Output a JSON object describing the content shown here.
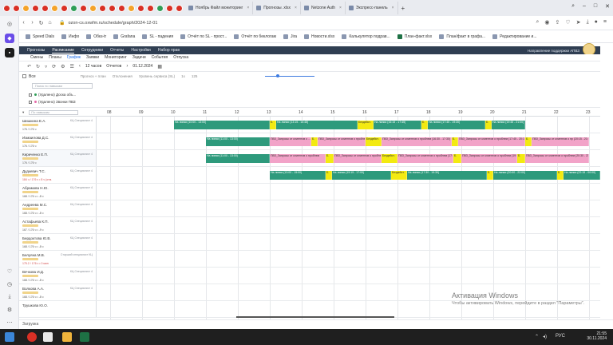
{
  "browser": {
    "tabs": [
      {
        "title": "Ноябрь Файл мониторинг"
      },
      {
        "title": "Прогнозы .xlsx"
      },
      {
        "title": "Netzone Auth"
      },
      {
        "title": "Экспресс-панель"
      }
    ],
    "url": "ozon-cs.oxwfm.ru/schedule/graph/2024-12-01",
    "bookmarks": [
      {
        "label": "Speed Dials"
      },
      {
        "label": "Инфо"
      },
      {
        "label": "Обкз-tr"
      },
      {
        "label": "Grafana"
      },
      {
        "label": "SL - падения"
      },
      {
        "label": "Отчёт по SL - прост..."
      },
      {
        "label": "Отчёт по беклогам"
      },
      {
        "label": "Jira"
      },
      {
        "label": "Новости.xlsx"
      },
      {
        "label": "Калькулятор подрав..."
      },
      {
        "label": "План-факт.xlsx"
      },
      {
        "label": "План/факт в графа..."
      },
      {
        "label": "Редактирование и..."
      }
    ]
  },
  "app": {
    "top_menu": [
      "Прогнозы",
      "Расписание",
      "Сотрудники",
      "Отчеты",
      "Настройки",
      "Набор прав"
    ],
    "active_top": "Расписание",
    "support": "Направление поддержки АПВЗ",
    "sub_menu": [
      "Смены",
      "Планы",
      "График",
      "Заявки",
      "Мониторинг",
      "Задачи",
      "События",
      "Отпуска"
    ],
    "active_sub": "График",
    "toolbar": {
      "view_hours": "12 часов",
      "view_span": "Отчетов",
      "date": "01.12.2024"
    },
    "filter": {
      "all_label": "Все",
      "options": [
        "Прогноз + план",
        "Отклонения",
        "Уровень сервиса (SL)",
        "1x",
        "125"
      ]
    },
    "group_panel": {
      "search_placeholder": "Поиск по навыкам",
      "items": [
        {
          "label": "(Удалено) Доска объ..."
        },
        {
          "label": "(Удалено) Звонки ПВЗ"
        }
      ]
    },
    "timeline": {
      "search_placeholder": "По навыкам",
      "hours": [
        "08",
        "09",
        "10",
        "11",
        "12",
        "13",
        "14",
        "15",
        "16",
        "17",
        "18",
        "19",
        "20",
        "21",
        "22",
        "23"
      ],
      "employees": [
        {
          "name": "Шишкина Е.А.",
          "role": "КЦ Специалист 4",
          "stat": "176 / 176 ч",
          "warn": false
        },
        {
          "name": "Измаилова Д.С.",
          "role": "КЦ Специалист 4",
          "stat": "176 / 176 ч",
          "warn": false
        },
        {
          "name": "Кириченко Е.П.",
          "role": "КЦ Специалист 4",
          "stat": "176 / 176 ч",
          "warn": false
        },
        {
          "name": "Дудкевич Т.С.",
          "role": "КЦ Специалист 4",
          "stat": "184 ч / 176 ч • 8 ч (отм.",
          "warn": true
        },
        {
          "name": "Абрамова Н.Ю.",
          "role": "КЦ Специалист 4",
          "stat": "168 / 176 ч • -8 ч",
          "warn": false
        },
        {
          "name": "Андреева М.С.",
          "role": "КЦ Специалист 4",
          "stat": "168 / 176 ч • -8 ч",
          "warn": false
        },
        {
          "name": "Астафьева К.П.",
          "role": "КЦ Специалист 4",
          "stat": "167 / 176 ч • -9 ч",
          "warn": false
        },
        {
          "name": "Бердоктова Ю.В.",
          "role": "КЦ Специалист 4",
          "stat": "168 / 176 ч • -8 ч",
          "warn": false
        },
        {
          "name": "Белуяна М.В.",
          "role": "Старший специалист КЦ",
          "stat": "175.2 / 176 ч • 0 мин",
          "warn": true
        },
        {
          "name": "Вечкова И.Д.",
          "role": "КЦ Специалист 4",
          "stat": "168 / 176 ч • -8 ч",
          "warn": false
        },
        {
          "name": "Волкова А.А.",
          "role": "КЦ Специалист 4",
          "stat": "168 / 176 ч • -8 ч",
          "warn": false
        },
        {
          "name": "Трушкова Ю.О.",
          "role": "",
          "stat": "",
          "warn": false
        }
      ],
      "segments": [
        [
          {
            "label": "На линии (10:00 - 13:00)",
            "type": "work",
            "start": 10.0,
            "end": 13.0
          },
          {
            "label": "Б.",
            "type": "brk",
            "start": 13.0,
            "end": 13.2
          },
          {
            "label": "На линии (13:15 - 15:45)",
            "type": "work",
            "start": 13.2,
            "end": 15.75
          },
          {
            "label": "Бездейст.",
            "type": "brk",
            "start": 15.75,
            "end": 16.25
          },
          {
            "label": "На линии (16:15 - 17:45)",
            "type": "work",
            "start": 16.25,
            "end": 17.75
          },
          {
            "label": "Б.",
            "type": "brk",
            "start": 17.75,
            "end": 17.95
          },
          {
            "label": "На линии (17:45 - 19:30)",
            "type": "work",
            "start": 17.95,
            "end": 19.75
          },
          {
            "label": "Б.",
            "type": "brk",
            "start": 19.75,
            "end": 19.95
          },
          {
            "label": "На линии (19:45 - 21:00)",
            "type": "work",
            "start": 19.95,
            "end": 21.0
          }
        ],
        [
          {
            "label": "На линии (11:00 - 13:00)",
            "type": "work",
            "start": 11.0,
            "end": 13.0
          },
          {
            "label": "ПВЗ_Запросы от клиентов о ...",
            "type": "pvz",
            "start": 13.0,
            "end": 14.3
          },
          {
            "label": "Б.",
            "type": "brk",
            "start": 14.3,
            "end": 14.5
          },
          {
            "label": "ПВЗ_Запросы от клиентов о проблем...",
            "type": "pvz",
            "start": 14.5,
            "end": 16.0
          },
          {
            "label": "Бездейст.",
            "type": "brk",
            "start": 16.0,
            "end": 16.5
          },
          {
            "label": "ПВЗ_Запросы от клиентов о проблем (16:30 - 17:30)",
            "type": "pvz",
            "start": 16.5,
            "end": 18.7
          },
          {
            "label": "Б.",
            "type": "brk",
            "start": 18.7,
            "end": 18.9
          },
          {
            "label": "ПВЗ_Запросы от клиентов о проблем (17:45 - 20:15)",
            "type": "pvz",
            "start": 18.9,
            "end": 21.0
          },
          {
            "label": "Б.",
            "type": "brk",
            "start": 21.0,
            "end": 21.2
          },
          {
            "label": "ПВЗ_Запросы от клиентов о пр (20:15 - 21:00)",
            "type": "pvz",
            "start": 21.2,
            "end": 23.0
          }
        ],
        [
          {
            "label": "На линии (11:00 - 13:00)",
            "type": "work",
            "start": 11.0,
            "end": 13.0
          },
          {
            "label": "ПВЗ_Запросы от клиентов о проблем",
            "type": "pvz",
            "start": 13.0,
            "end": 14.75
          },
          {
            "label": "Б.",
            "type": "brk",
            "start": 14.75,
            "end": 15.0
          },
          {
            "label": "ПВЗ_Запросы от клиентов о проблем (14:45)",
            "type": "pvz",
            "start": 15.0,
            "end": 16.5
          },
          {
            "label": "Бездейст.",
            "type": "brk",
            "start": 16.5,
            "end": 17.0
          },
          {
            "label": "ПВЗ_Запросы от клиентов о проблем (17:00 - 19:00)",
            "type": "pvz",
            "start": 17.0,
            "end": 18.75
          },
          {
            "label": "Б.",
            "type": "brk",
            "start": 18.75,
            "end": 19.0
          },
          {
            "label": "ПВЗ_Запросы от клиентов о проблем (19:00 - 20:15)",
            "type": "pvz",
            "start": 19.0,
            "end": 20.75
          },
          {
            "label": "Б.",
            "type": "brk",
            "start": 20.75,
            "end": 21.0
          },
          {
            "label": "ПВЗ_Запросы от клиентов о проблем (20:30 - 23:00)",
            "type": "pvz",
            "start": 21.0,
            "end": 23.0
          }
        ],
        [
          {
            "label": "На линии (13:00 - 15:00)",
            "type": "work",
            "start": 13.0,
            "end": 14.75
          },
          {
            "label": "Б.",
            "type": "brk",
            "start": 14.75,
            "end": 14.95
          },
          {
            "label": "На линии (15:15 - 17:00)",
            "type": "work",
            "start": 14.95,
            "end": 16.8
          },
          {
            "label": "Бездейст.",
            "type": "brk",
            "start": 16.8,
            "end": 17.3
          },
          {
            "label": "На линии (17:30 - 19:30)",
            "type": "work",
            "start": 17.3,
            "end": 19.8
          },
          {
            "label": "Б.",
            "type": "brk",
            "start": 19.8,
            "end": 20.0
          },
          {
            "label": "На линии (20:00 - 22:00)",
            "type": "work",
            "start": 20.0,
            "end": 22.0
          },
          {
            "label": "Б.",
            "type": "brk",
            "start": 22.0,
            "end": 22.2
          },
          {
            "label": "На линии (22:15 - 00:00)",
            "type": "work",
            "start": 22.2,
            "end": 24.0
          }
        ]
      ]
    },
    "status_bar": "Загрузка"
  },
  "watermark": {
    "title": "Активация Windows",
    "line": "Чтобы активировать Windows, перейдите в раздел \"Параметры\"."
  },
  "taskbar": {
    "lang": "РУС",
    "time": "21:55",
    "date": "30.11.2024"
  }
}
